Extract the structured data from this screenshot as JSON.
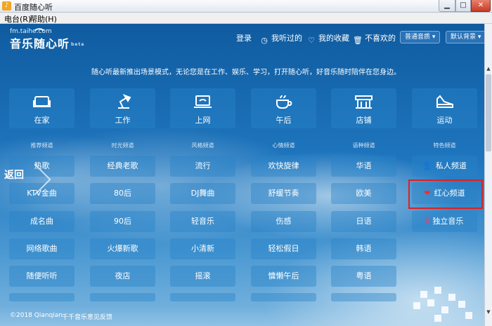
{
  "window": {
    "title": "百度随心听",
    "min_glyph": "▁",
    "max_glyph": "□",
    "close_glyph": "✕"
  },
  "menu": {
    "items": [
      "电台(R)",
      "帮助(H)"
    ]
  },
  "logo": {
    "url": "fm.taihe.com",
    "name": "音乐随心听",
    "badge": "beta"
  },
  "nav": {
    "login": "登录",
    "history": "我听过的",
    "favorites": "我的收藏",
    "dislikes": "不喜欢的",
    "quality": "普通音质",
    "background": "默认背景"
  },
  "intro": "随心听最新推出场景模式，无论您是在工作、娱乐、学习，打开随心听，好音乐随时陪伴在您身边。",
  "scenes": [
    {
      "label": "在家",
      "icon": "sofa-icon"
    },
    {
      "label": "工作",
      "icon": "desk-lamp-icon"
    },
    {
      "label": "上网",
      "icon": "laptop-wifi-icon"
    },
    {
      "label": "午后",
      "icon": "coffee-cup-icon"
    },
    {
      "label": "店铺",
      "icon": "storefront-icon"
    },
    {
      "label": "运动",
      "icon": "sneaker-icon"
    }
  ],
  "categories": [
    "推荐频道",
    "时光频道",
    "风格频道",
    "心情频道",
    "语种频道",
    "特色频道"
  ],
  "channels": [
    [
      "热歌",
      "经典老歌",
      "流行",
      "欢快旋律",
      "华语",
      "私人频道"
    ],
    [
      "KTV金曲",
      "80后",
      "DJ舞曲",
      "舒缓节奏",
      "欧美",
      "红心频道"
    ],
    [
      "成名曲",
      "90后",
      "轻音乐",
      "伤感",
      "日语",
      "独立音乐"
    ],
    [
      "网络歌曲",
      "火爆新歌",
      "小清新",
      "轻松假日",
      "韩语",
      ""
    ],
    [
      "随便听听",
      "夜店",
      "摇滚",
      "慵懒午后",
      "粤语",
      ""
    ]
  ],
  "special_icons": {
    "私人频道": "person-icon",
    "红心频道": "heart-icon",
    "独立音乐": "soundwave-icon"
  },
  "colors": {
    "highlight": "#e02020",
    "heart": "#ff2a2a",
    "indie": "#e8407a"
  },
  "back_label": "返回",
  "footer": {
    "copyright": "©2018 Qianqian",
    "link1": "千千音乐",
    "link2": "意见反馈"
  }
}
